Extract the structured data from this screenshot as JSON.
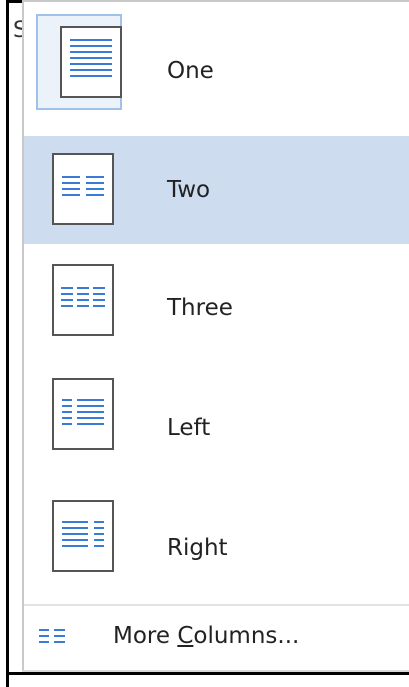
{
  "menu": {
    "items": [
      {
        "id": "one",
        "label": "One",
        "icon": "one-column-icon",
        "columns": 1
      },
      {
        "id": "two",
        "label": "Two",
        "icon": "two-columns-icon",
        "columns": 2
      },
      {
        "id": "three",
        "label": "Three",
        "icon": "three-columns-icon",
        "columns": 3
      },
      {
        "id": "left",
        "label": "Left",
        "icon": "left-column-icon",
        "columns": 2
      },
      {
        "id": "right",
        "label": "Right",
        "icon": "right-column-icon",
        "columns": 2
      }
    ],
    "selected": "one",
    "hovered": "two",
    "more": {
      "label_before": "More ",
      "label_mnemonic": "C",
      "label_after": "olumns...",
      "icon": "more-columns-icon"
    }
  },
  "colors": {
    "hover_bg": "#cddcef",
    "selected_bg": "#ecf2fa",
    "selected_border": "#9ec2ea",
    "line_blue": "#3a7bd5"
  },
  "partial_text": "S"
}
